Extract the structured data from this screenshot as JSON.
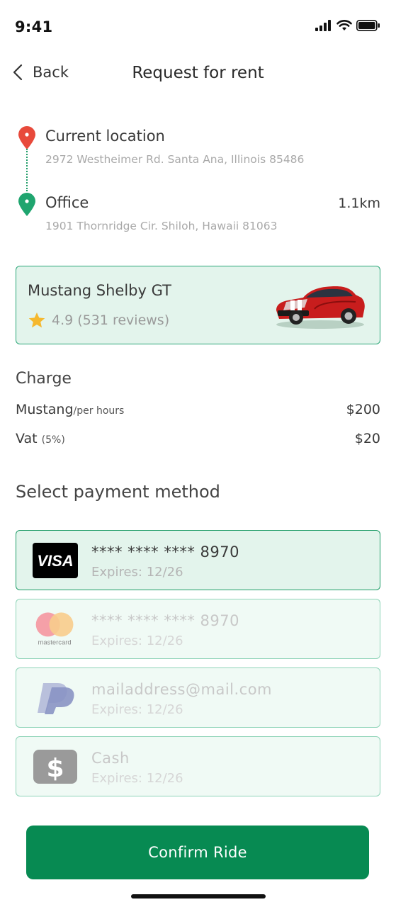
{
  "status_bar": {
    "time": "9:41"
  },
  "header": {
    "back_label": "Back",
    "title": "Request for rent"
  },
  "route": {
    "from": {
      "title": "Current location",
      "address": "2972 Westheimer Rd. Santa Ana, Illinois 85486"
    },
    "to": {
      "title": "Office",
      "address": "1901 Thornridge Cir. Shiloh, Hawaii 81063",
      "distance": "1.1km"
    }
  },
  "car": {
    "name": "Mustang Shelby GT",
    "rating": "4.9 (531 reviews)"
  },
  "charge": {
    "heading": "Charge",
    "rows": [
      {
        "label": "Mustang",
        "sub": "/per hours",
        "value": "$200"
      },
      {
        "label": "Vat",
        "sub": "(5%)",
        "value": "$20"
      }
    ]
  },
  "payment": {
    "heading": "Select payment method",
    "methods": [
      {
        "logo": "visa-logo",
        "title": "**** **** **** 8970",
        "sub": "Expires: 12/26",
        "selected": true
      },
      {
        "logo": "mastercard-logo",
        "logo_text": "mastercard",
        "title": "**** **** **** 8970",
        "sub": "Expires: 12/26",
        "selected": false
      },
      {
        "logo": "paypal-logo",
        "title": "mailaddress@mail.com",
        "sub": "Expires: 12/26",
        "selected": false
      },
      {
        "logo": "cash-icon",
        "title": "Cash",
        "sub": "Expires: 12/26",
        "selected": false
      }
    ]
  },
  "confirm_label": "Confirm Ride",
  "colors": {
    "accent": "#078a52",
    "card_bg": "#e3f4ec",
    "border": "#2aa677",
    "pin_red": "#e84a3b",
    "pin_green": "#1fa56f"
  }
}
